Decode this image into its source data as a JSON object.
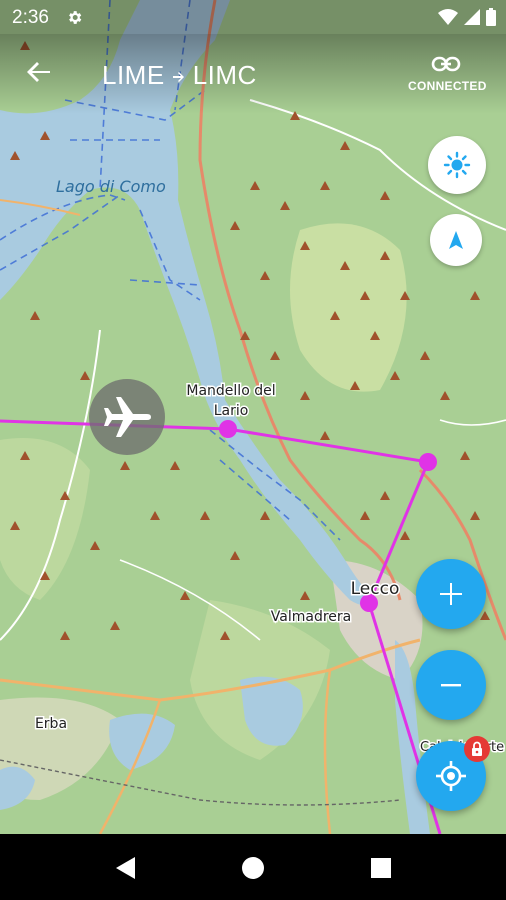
{
  "status": {
    "time": "2:36",
    "icons": [
      "gear-icon",
      "wifi-icon",
      "signal-icon",
      "battery-icon"
    ]
  },
  "header": {
    "origin": "LIME",
    "destination": "LIMC",
    "connection_label": "CONNECTED",
    "icons": [
      "back-arrow-icon",
      "route-arrow-icon",
      "link-icon"
    ]
  },
  "map": {
    "places": [
      {
        "name": "Lago di Como"
      },
      {
        "name": "Mandello del"
      },
      {
        "name": "Lario"
      },
      {
        "name": "Lecco"
      },
      {
        "name": "Valmadrera"
      },
      {
        "name": "Erba"
      },
      {
        "name": "Calolziocorte"
      }
    ],
    "route_color": "#e033e6",
    "water_color": "#a9cbe0",
    "land_color": "#a9cf94"
  },
  "controls": {
    "icons": [
      "brightness-icon",
      "north-arrow-icon",
      "plus-icon",
      "minus-icon",
      "my-location-icon",
      "lock-icon",
      "airplane-icon"
    ],
    "accent_color": "#23a8ef"
  },
  "nav": {
    "icons": [
      "back-triangle-icon",
      "home-circle-icon",
      "recents-square-icon"
    ]
  }
}
